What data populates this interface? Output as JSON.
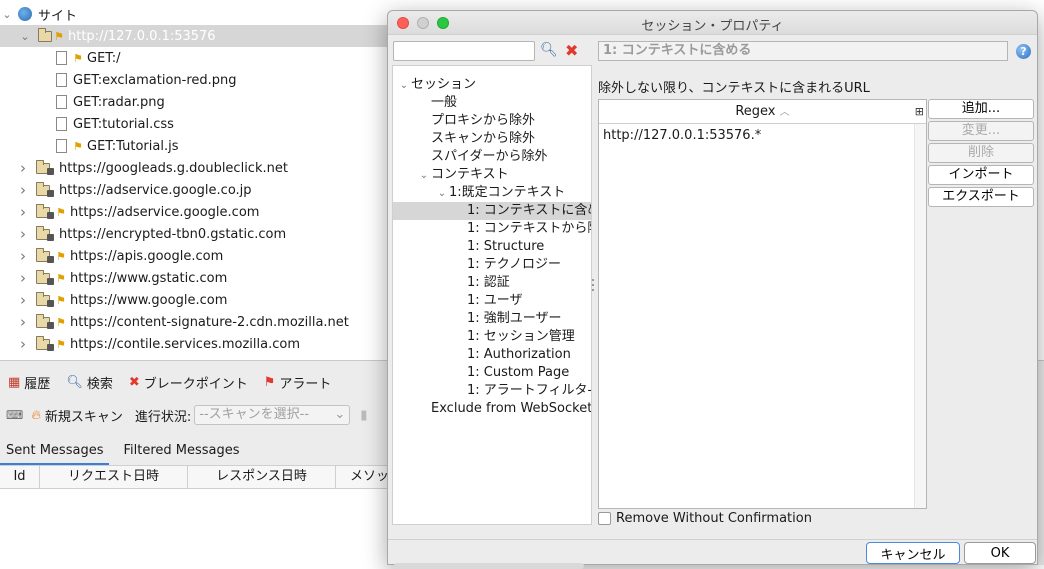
{
  "sites": {
    "root": "サイト",
    "selected_host": "http://127.0.0.1:53576",
    "children": [
      "GET:/",
      "GET:exclamation-red.png",
      "GET:radar.png",
      "GET:tutorial.css",
      "GET:Tutorial.js"
    ],
    "hosts": [
      "https://googleads.g.doubleclick.net",
      "https://adservice.google.co.jp",
      "https://adservice.google.com",
      "https://encrypted-tbn0.gstatic.com",
      "https://apis.google.com",
      "https://www.gstatic.com",
      "https://www.google.com",
      "https://content-signature-2.cdn.mozilla.net",
      "https://contile.services.mozilla.com"
    ]
  },
  "bottom": {
    "tabs": [
      "履歴",
      "検索",
      "ブレークポイント",
      "アラート"
    ],
    "new_scan": "新規スキャン",
    "progress_label": "進行状況:",
    "scan_select": "--スキャンを選択--",
    "subtabs": [
      "Sent Messages",
      "Filtered Messages"
    ],
    "columns": [
      "Id",
      "リクエスト日時",
      "レスポンス日時",
      "メソッド"
    ]
  },
  "dialog": {
    "title": "セッション・プロパティ",
    "tree": [
      "セッション",
      "一般",
      "プロキシから除外",
      "スキャンから除外",
      "スパイダーから除外",
      "コンテキスト",
      "1:既定コンテキスト",
      "1: コンテキストに含め",
      "1: コンテキストから除",
      "1: Structure",
      "1: テクノロジー",
      "1: 認証",
      "1: ユーザ",
      "1: 強制ユーザー",
      "1: セッション管理",
      "1: Authorization",
      "1: Custom Page",
      "1: アラートフィルタ-",
      "Exclude from WebSockets"
    ],
    "panel_title": "1: コンテキストに含める",
    "description": "除外しない限り、コンテキストに含まれるURL",
    "regex_header": "Regex",
    "regex_rows": [
      "http://127.0.0.1:53576.*"
    ],
    "buttons": [
      "追加...",
      "変更...",
      "削除",
      "インポート",
      "エクスポート"
    ],
    "remove_without_confirmation": "Remove Without Confirmation",
    "cancel": "キャンセル",
    "ok": "OK"
  },
  "colors": {
    "accent": "#3d7ed6",
    "close": "#ff5f57",
    "minimize": "#d0d0d0",
    "zoom": "#28c840"
  }
}
